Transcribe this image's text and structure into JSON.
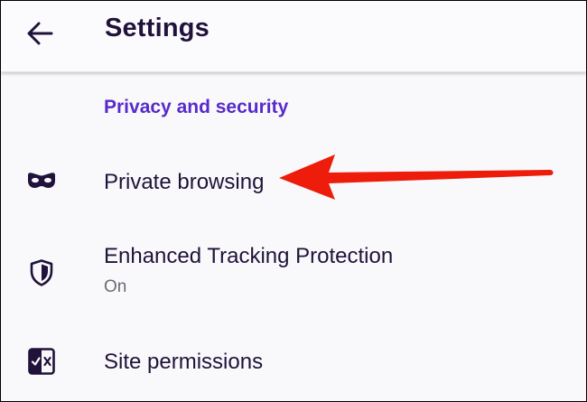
{
  "app_bar": {
    "title": "Settings",
    "back_icon": "arrow-left-icon"
  },
  "section": {
    "header": "Privacy and security"
  },
  "items": [
    {
      "label": "Private browsing",
      "icon": "private-mask-icon"
    },
    {
      "label": "Enhanced Tracking Protection",
      "status": "On",
      "icon": "shield-icon"
    },
    {
      "label": "Site permissions",
      "icon": "site-permissions-icon"
    }
  ],
  "annotation": {
    "icon": "red-callout-arrow",
    "color": "#ee1c0a"
  },
  "colors": {
    "accent": "#592acb",
    "text_primary": "#20123a",
    "text_secondary": "#6b6a73",
    "background": "#f9f9fb"
  }
}
